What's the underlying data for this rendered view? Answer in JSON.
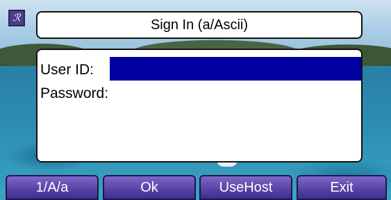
{
  "app": {
    "icon": "app-logo-icon",
    "icon_glyph": "ℛ"
  },
  "title": "Sign In (a/Ascii)",
  "form": {
    "user_id_label": "User ID:",
    "user_id_value": "",
    "password_label": "Password:",
    "password_value": ""
  },
  "softkeys": [
    "1/A/a",
    "Ok",
    "UseHost",
    "Exit"
  ],
  "colors": {
    "input_focus": "#0000a0",
    "softkey": "#5a45a8",
    "panel": "#ffffff"
  }
}
